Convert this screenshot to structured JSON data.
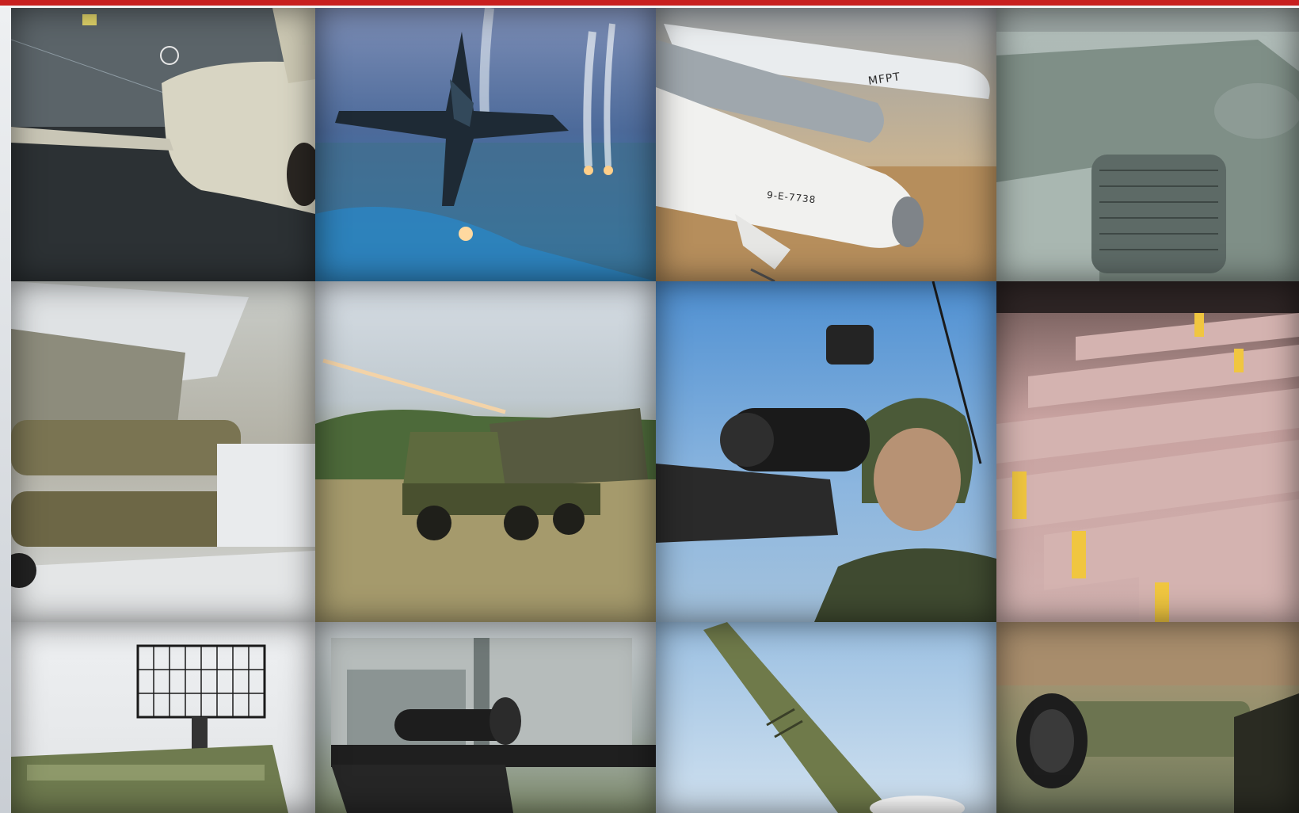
{
  "page": {
    "accent_color": "#c8201f"
  },
  "tiles": [
    {
      "id": "t1",
      "subject": "cruise-missile-in-flight-icon",
      "label": ""
    },
    {
      "id": "t2",
      "subject": "fighter-jet-firing-flares-icon",
      "label": ""
    },
    {
      "id": "t3",
      "subject": "white-missiles-display-icon",
      "label": "MFPT",
      "label2": "9-E-7738"
    },
    {
      "id": "t4",
      "subject": "tank-turret-icon",
      "label": ""
    },
    {
      "id": "t5",
      "subject": "aircraft-weapon-pylon-icon",
      "label": ""
    },
    {
      "id": "t6",
      "subject": "rocket-launcher-truck-icon",
      "label": ""
    },
    {
      "id": "t7",
      "subject": "soldier-with-scope-icon",
      "label": ""
    },
    {
      "id": "t8",
      "subject": "stacked-bombs-icon",
      "label": ""
    },
    {
      "id": "t9",
      "subject": "radar-air-defense-vehicle-icon",
      "label": ""
    },
    {
      "id": "t10",
      "subject": "sniper-rifle-icon",
      "label": ""
    },
    {
      "id": "t11",
      "subject": "ballistic-missile-launch-icon",
      "label": ""
    },
    {
      "id": "t12",
      "subject": "anti-tank-launcher-icon",
      "label": ""
    }
  ]
}
